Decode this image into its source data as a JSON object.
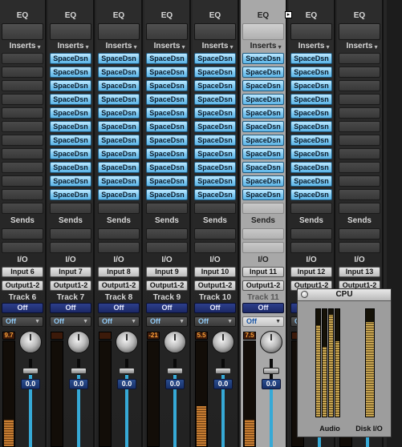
{
  "labels": {
    "eq": "EQ",
    "inserts": "Inserts",
    "sends": "Sends",
    "io": "I/O",
    "output": "Output1-2",
    "off": "Off",
    "fader_value": "0.0"
  },
  "strips": [
    {
      "input": "Input 6",
      "track": "Track 6",
      "peak": "9.7",
      "meter_level": 0.25,
      "inserts": [
        "",
        "",
        "",
        "",
        "",
        "",
        "",
        "",
        "",
        "",
        "",
        ""
      ]
    },
    {
      "input": "Input 7",
      "track": "Track 7",
      "peak": "",
      "meter_level": 0.0,
      "inserts": [
        "SpaceDsn",
        "SpaceDsn",
        "SpaceDsn",
        "SpaceDsn",
        "SpaceDsn",
        "SpaceDsn",
        "SpaceDsn",
        "SpaceDsn",
        "SpaceDsn",
        "SpaceDsn",
        "SpaceDsn",
        ""
      ]
    },
    {
      "input": "Input 8",
      "track": "Track 8",
      "peak": "",
      "meter_level": 0.0,
      "inserts": [
        "SpaceDsn",
        "SpaceDsn",
        "SpaceDsn",
        "SpaceDsn",
        "SpaceDsn",
        "SpaceDsn",
        "SpaceDsn",
        "SpaceDsn",
        "SpaceDsn",
        "SpaceDsn",
        "SpaceDsn",
        ""
      ]
    },
    {
      "input": "Input 9",
      "track": "Track 9",
      "peak": "-21",
      "meter_level": 0.0,
      "inserts": [
        "SpaceDsn",
        "SpaceDsn",
        "SpaceDsn",
        "SpaceDsn",
        "SpaceDsn",
        "SpaceDsn",
        "SpaceDsn",
        "SpaceDsn",
        "SpaceDsn",
        "SpaceDsn",
        "SpaceDsn",
        ""
      ]
    },
    {
      "input": "Input 10",
      "track": "Track 10",
      "peak": "5.5",
      "meter_level": 0.38,
      "inserts": [
        "SpaceDsn",
        "SpaceDsn",
        "SpaceDsn",
        "SpaceDsn",
        "SpaceDsn",
        "SpaceDsn",
        "SpaceDsn",
        "SpaceDsn",
        "SpaceDsn",
        "SpaceDsn",
        "SpaceDsn",
        ""
      ]
    },
    {
      "input": "Input 11",
      "track": "Track 11",
      "peak": "7.5",
      "meter_level": 0.25,
      "inserts": [
        "SpaceDsn",
        "SpaceDsn",
        "SpaceDsn",
        "SpaceDsn",
        "SpaceDsn",
        "SpaceDsn",
        "SpaceDsn",
        "SpaceDsn",
        "SpaceDsn",
        "SpaceDsn",
        "SpaceDsn",
        ""
      ],
      "selected": true
    },
    {
      "input": "Input 12",
      "track": "",
      "peak": "",
      "meter_level": 0.0,
      "inserts": [
        "SpaceDsn",
        "SpaceDsn",
        "SpaceDsn",
        "SpaceDsn",
        "SpaceDsn",
        "SpaceDsn",
        "SpaceDsn",
        "SpaceDsn",
        "SpaceDsn",
        "SpaceDsn",
        "SpaceDsn",
        ""
      ]
    },
    {
      "input": "Input 13",
      "track": "",
      "peak": "",
      "meter_level": 0.0,
      "inserts": [
        "",
        "",
        "",
        "",
        "",
        "",
        "",
        "",
        "",
        "",
        "",
        ""
      ]
    }
  ],
  "cpu_window": {
    "title": "CPU",
    "audio_label": "Audio",
    "disk_label": "Disk I/O",
    "audio_levels": [
      0.85,
      0.65,
      0.95,
      0.7
    ],
    "disk_level": 0.88
  }
}
